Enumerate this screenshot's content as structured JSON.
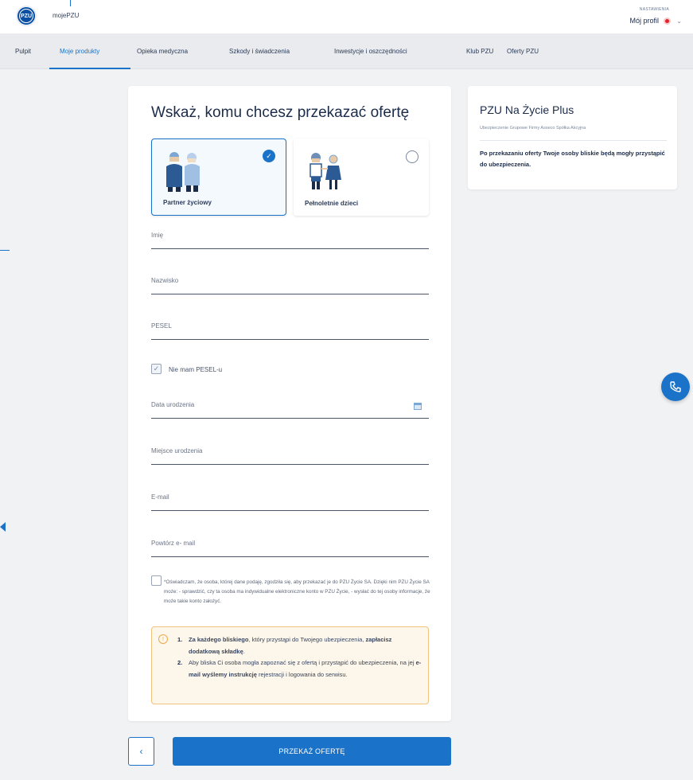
{
  "header": {
    "brand": "mojePZU",
    "logo_text": "PZU",
    "profile_caption": "NASTAWIENIA",
    "profile_label": "Mój profil"
  },
  "nav": {
    "items": [
      {
        "label": "Pulpit",
        "active": false
      },
      {
        "label": "Moje produkty",
        "active": true
      },
      {
        "label": "Opieka medyczna",
        "active": false
      },
      {
        "label": "Szkody i świadczenia",
        "active": false
      },
      {
        "label": "Inwestycje i oszczędności",
        "active": false
      },
      {
        "label": "Klub PZU",
        "active": false
      },
      {
        "label": "Oferty PZU",
        "active": false
      }
    ]
  },
  "form": {
    "title": "Wskaż, komu chcesz przekazać ofertę",
    "options": [
      {
        "label": "Partner życiowy",
        "selected": true
      },
      {
        "label": "Pełnoletnie dzieci",
        "selected": false
      }
    ],
    "fields": {
      "first_name": "Imię",
      "last_name": "Nazwisko",
      "pesel": "PESEL",
      "no_pesel": "Nie mam PESEL-u",
      "birth_date": "Data urodzenia",
      "birth_place": "Miejsce urodzenia",
      "email": "E-mail",
      "email_repeat": "Powtórz e- mail"
    },
    "no_pesel_checked": true,
    "consent_checked": false,
    "consent_text": "*Oświadczam, że osoba, której dane podaję, zgodziła się, aby przekazać je do PZU Życie SA. Dzięki nim PZU Życie SA może: - sprawdzić, czy ta osoba ma indywidualne elektroniczne konto w PZU Życie, - wysłać do tej osoby informacje, że może takie konto założyć.",
    "info": {
      "item1_num": "1.",
      "item1_b1": "Za każdego bliskiego",
      "item1_t1": ", który przystąpi do Twojego ubezpieczenia, ",
      "item1_b2": "zapłacisz dodatkową składkę",
      "item1_t2": ".",
      "item2_num": "2.",
      "item2_t1": "Aby bliska Ci osoba mogła zapoznać się z ofertą i przystąpić do ubezpieczenia, na jej ",
      "item2_b1": "e-mail wyślemy instrukcję",
      "item2_t2": " rejestracji i logowania do serwisu."
    },
    "submit_label": "PRZEKAŻ OFERTĘ"
  },
  "product": {
    "title": "PZU Na Życie Plus",
    "subtitle": "Ubezpieczenie Grupowe Firmy Asseco Spółka Akcyjna",
    "description": "Po przekazaniu oferty Twoje osoby bliskie będą mogły przystąpić do ubezpieczenia."
  },
  "colors": {
    "accent": "#1a73c9",
    "notice_border": "#f0c27a",
    "notice_bg": "#fdf6ea",
    "badge": "#e0242b"
  }
}
